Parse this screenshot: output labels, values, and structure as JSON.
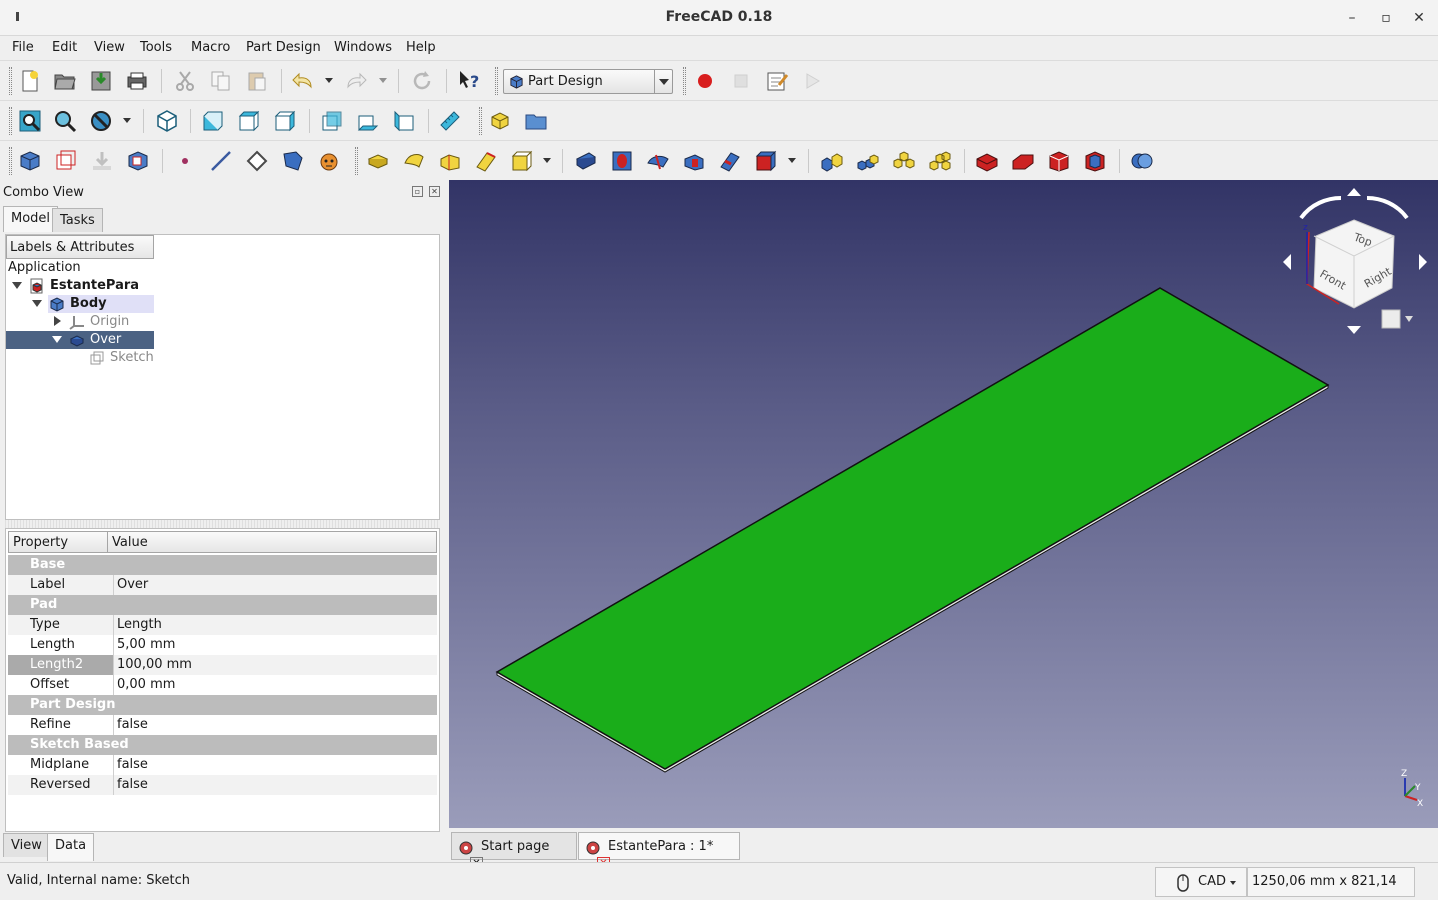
{
  "window": {
    "title": "FreeCAD 0.18",
    "minimize": "–",
    "maximize": "▫",
    "close": "✕"
  },
  "menu": [
    "File",
    "Edit",
    "View",
    "Tools",
    "Macro",
    "Part Design",
    "Windows",
    "Help"
  ],
  "workbench": {
    "selected": "Part Design"
  },
  "combo_view": {
    "title": "Combo View",
    "tabs": [
      "Model",
      "Tasks"
    ],
    "tree_header": "Labels & Attributes",
    "tree": {
      "root": "Application",
      "document": "EstantePara",
      "body": "Body",
      "origin": "Origin",
      "feature": "Over",
      "sketch": "Sketch"
    },
    "property_header": {
      "property": "Property",
      "value": "Value"
    },
    "properties": [
      {
        "group": "Base"
      },
      {
        "name": "Label",
        "value": "Over"
      },
      {
        "group": "Pad"
      },
      {
        "name": "Type",
        "value": "Length"
      },
      {
        "name": "Length",
        "value": "5,00 mm"
      },
      {
        "name": "Length2",
        "value": "100,00 mm"
      },
      {
        "name": "Offset",
        "value": "0,00 mm"
      },
      {
        "group": "Part Design"
      },
      {
        "name": "Refine",
        "value": "false"
      },
      {
        "group": "Sketch Based"
      },
      {
        "name": "Midplane",
        "value": "false"
      },
      {
        "name": "Reversed",
        "value": "false"
      }
    ],
    "bottom_tabs": [
      "View",
      "Data"
    ]
  },
  "navcube": {
    "top": "Top",
    "front": "Front",
    "right": "Right"
  },
  "axes": {
    "x": "X",
    "y": "Y",
    "z": "Z"
  },
  "doc_tabs": [
    {
      "label": "Start page",
      "close": "✕"
    },
    {
      "label": "EstantePara : 1*",
      "close": "✕"
    }
  ],
  "status": {
    "message": "Valid, Internal name: Sketch",
    "nav_style": "CAD",
    "dimensions": "1250,06 mm x 821,14 mm"
  },
  "colors": {
    "model_face": "#1aad1a",
    "viewport_top": "#323466",
    "viewport_bottom": "#9a9cba"
  }
}
